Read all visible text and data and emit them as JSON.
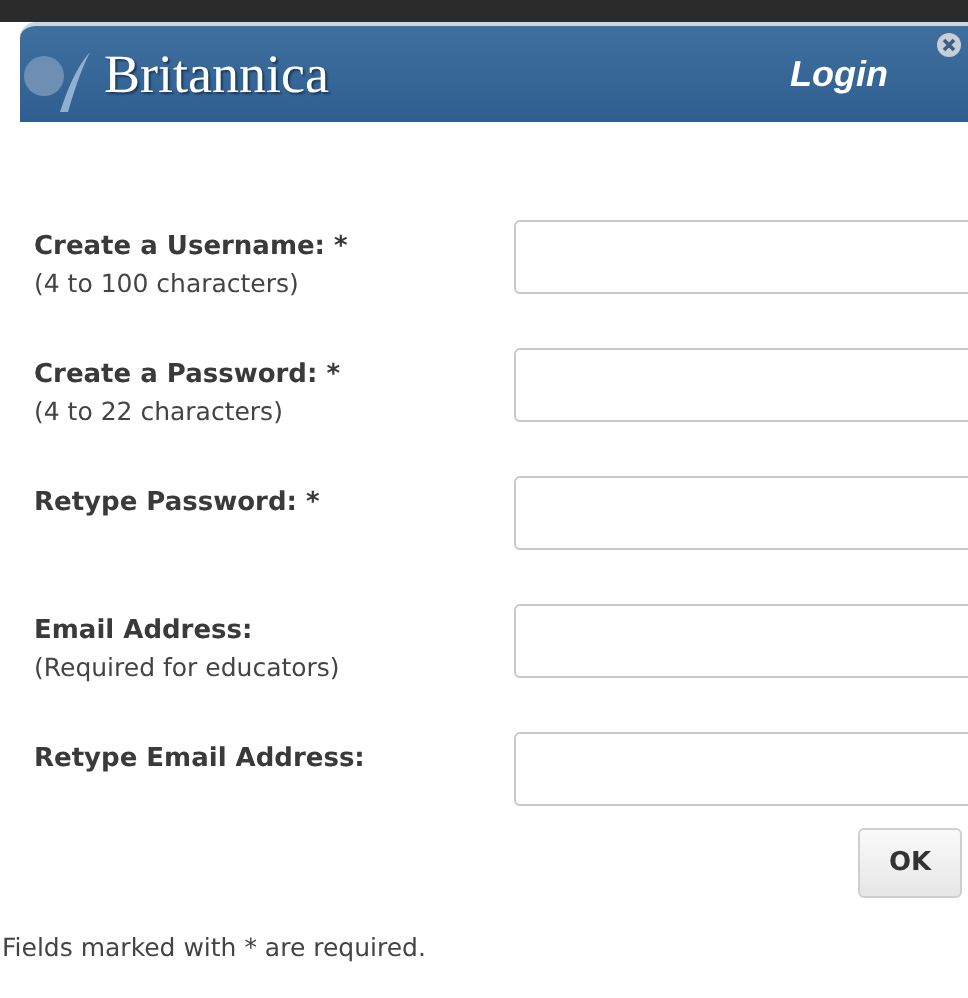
{
  "header": {
    "brand": "Britannica",
    "title": "Login"
  },
  "fields": [
    {
      "label": "Create a Username: *",
      "hint": "(4 to 100 characters)"
    },
    {
      "label": "Create a Password: *",
      "hint": "(4 to 22 characters)"
    },
    {
      "label": "Retype Password: *"
    },
    {
      "label": "Email Address:",
      "hint": "(Required for educators)"
    },
    {
      "label": "Retype Email Address:"
    }
  ],
  "button": "OK",
  "footnote": "Fields marked with * are required."
}
